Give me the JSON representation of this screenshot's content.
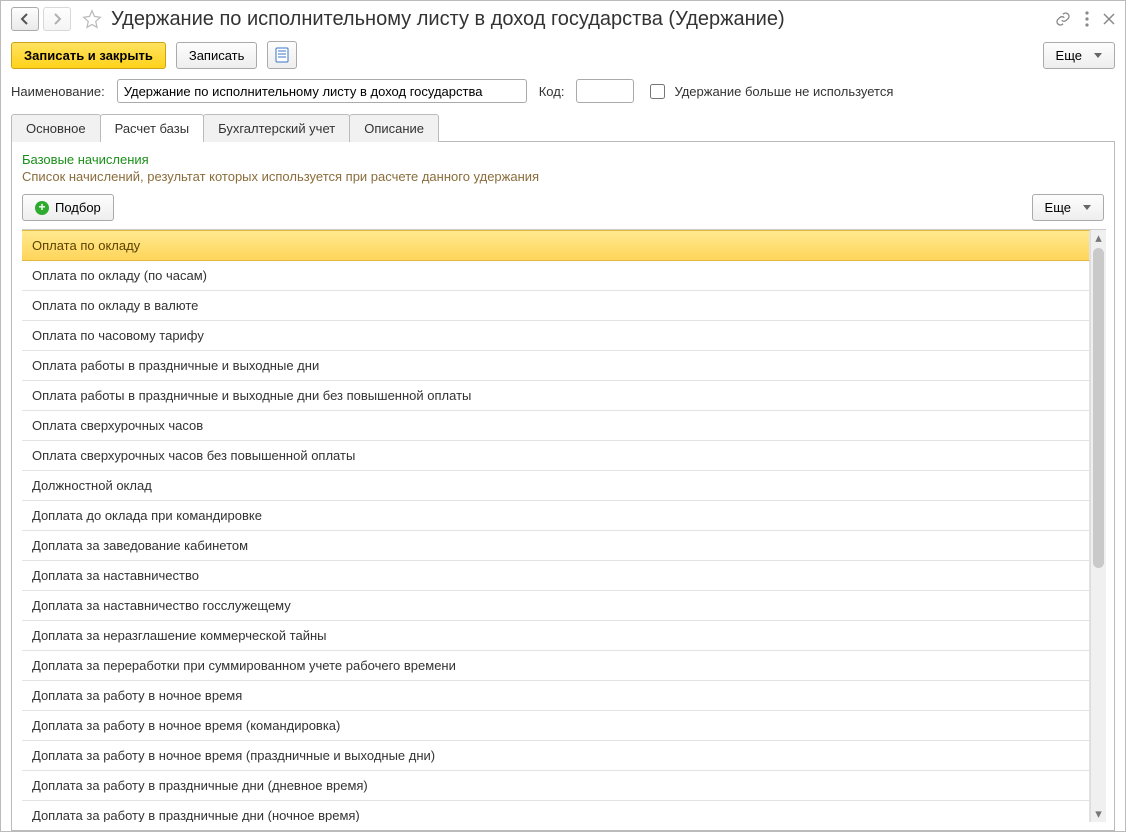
{
  "header": {
    "title": "Удержание по исполнительному листу в доход государства (Удержание)"
  },
  "toolbar": {
    "save_close": "Записать и закрыть",
    "save": "Записать",
    "more": "Еще"
  },
  "fields": {
    "name_label": "Наименование:",
    "name_value": "Удержание по исполнительному листу в доход государства",
    "code_label": "Код:",
    "code_value": "",
    "unused_label": "Удержание больше не используется"
  },
  "tabs": {
    "items": [
      "Основное",
      "Расчет базы",
      "Бухгалтерский учет",
      "Описание"
    ],
    "active_index": 1
  },
  "base": {
    "title": "Базовые начисления",
    "subtitle": "Список начислений, результат которых используется при расчете данного удержания",
    "pick": "Подбор",
    "more": "Еще",
    "rows": [
      "Оплата по окладу",
      "Оплата по окладу (по часам)",
      "Оплата по окладу в валюте",
      "Оплата по часовому тарифу",
      "Оплата работы в праздничные и выходные дни",
      "Оплата работы в праздничные и выходные дни без повышенной оплаты",
      "Оплата сверхурочных часов",
      "Оплата сверхурочных часов без повышенной оплаты",
      "Должностной оклад",
      "Доплата до оклада при командировке",
      "Доплата за заведование кабинетом",
      "Доплата за наставничество",
      "Доплата за наставничество госслужещему",
      "Доплата за неразглашение коммерческой тайны",
      "Доплата за переработки при суммированном учете рабочего времени",
      "Доплата за работу в ночное время",
      "Доплата за работу в ночное время (командировка)",
      "Доплата за работу в ночное время (праздничные и выходные дни)",
      "Доплата за работу в праздничные дни (дневное время)",
      "Доплата за работу в праздничные дни (ночное время)"
    ],
    "selected_index": 0
  }
}
